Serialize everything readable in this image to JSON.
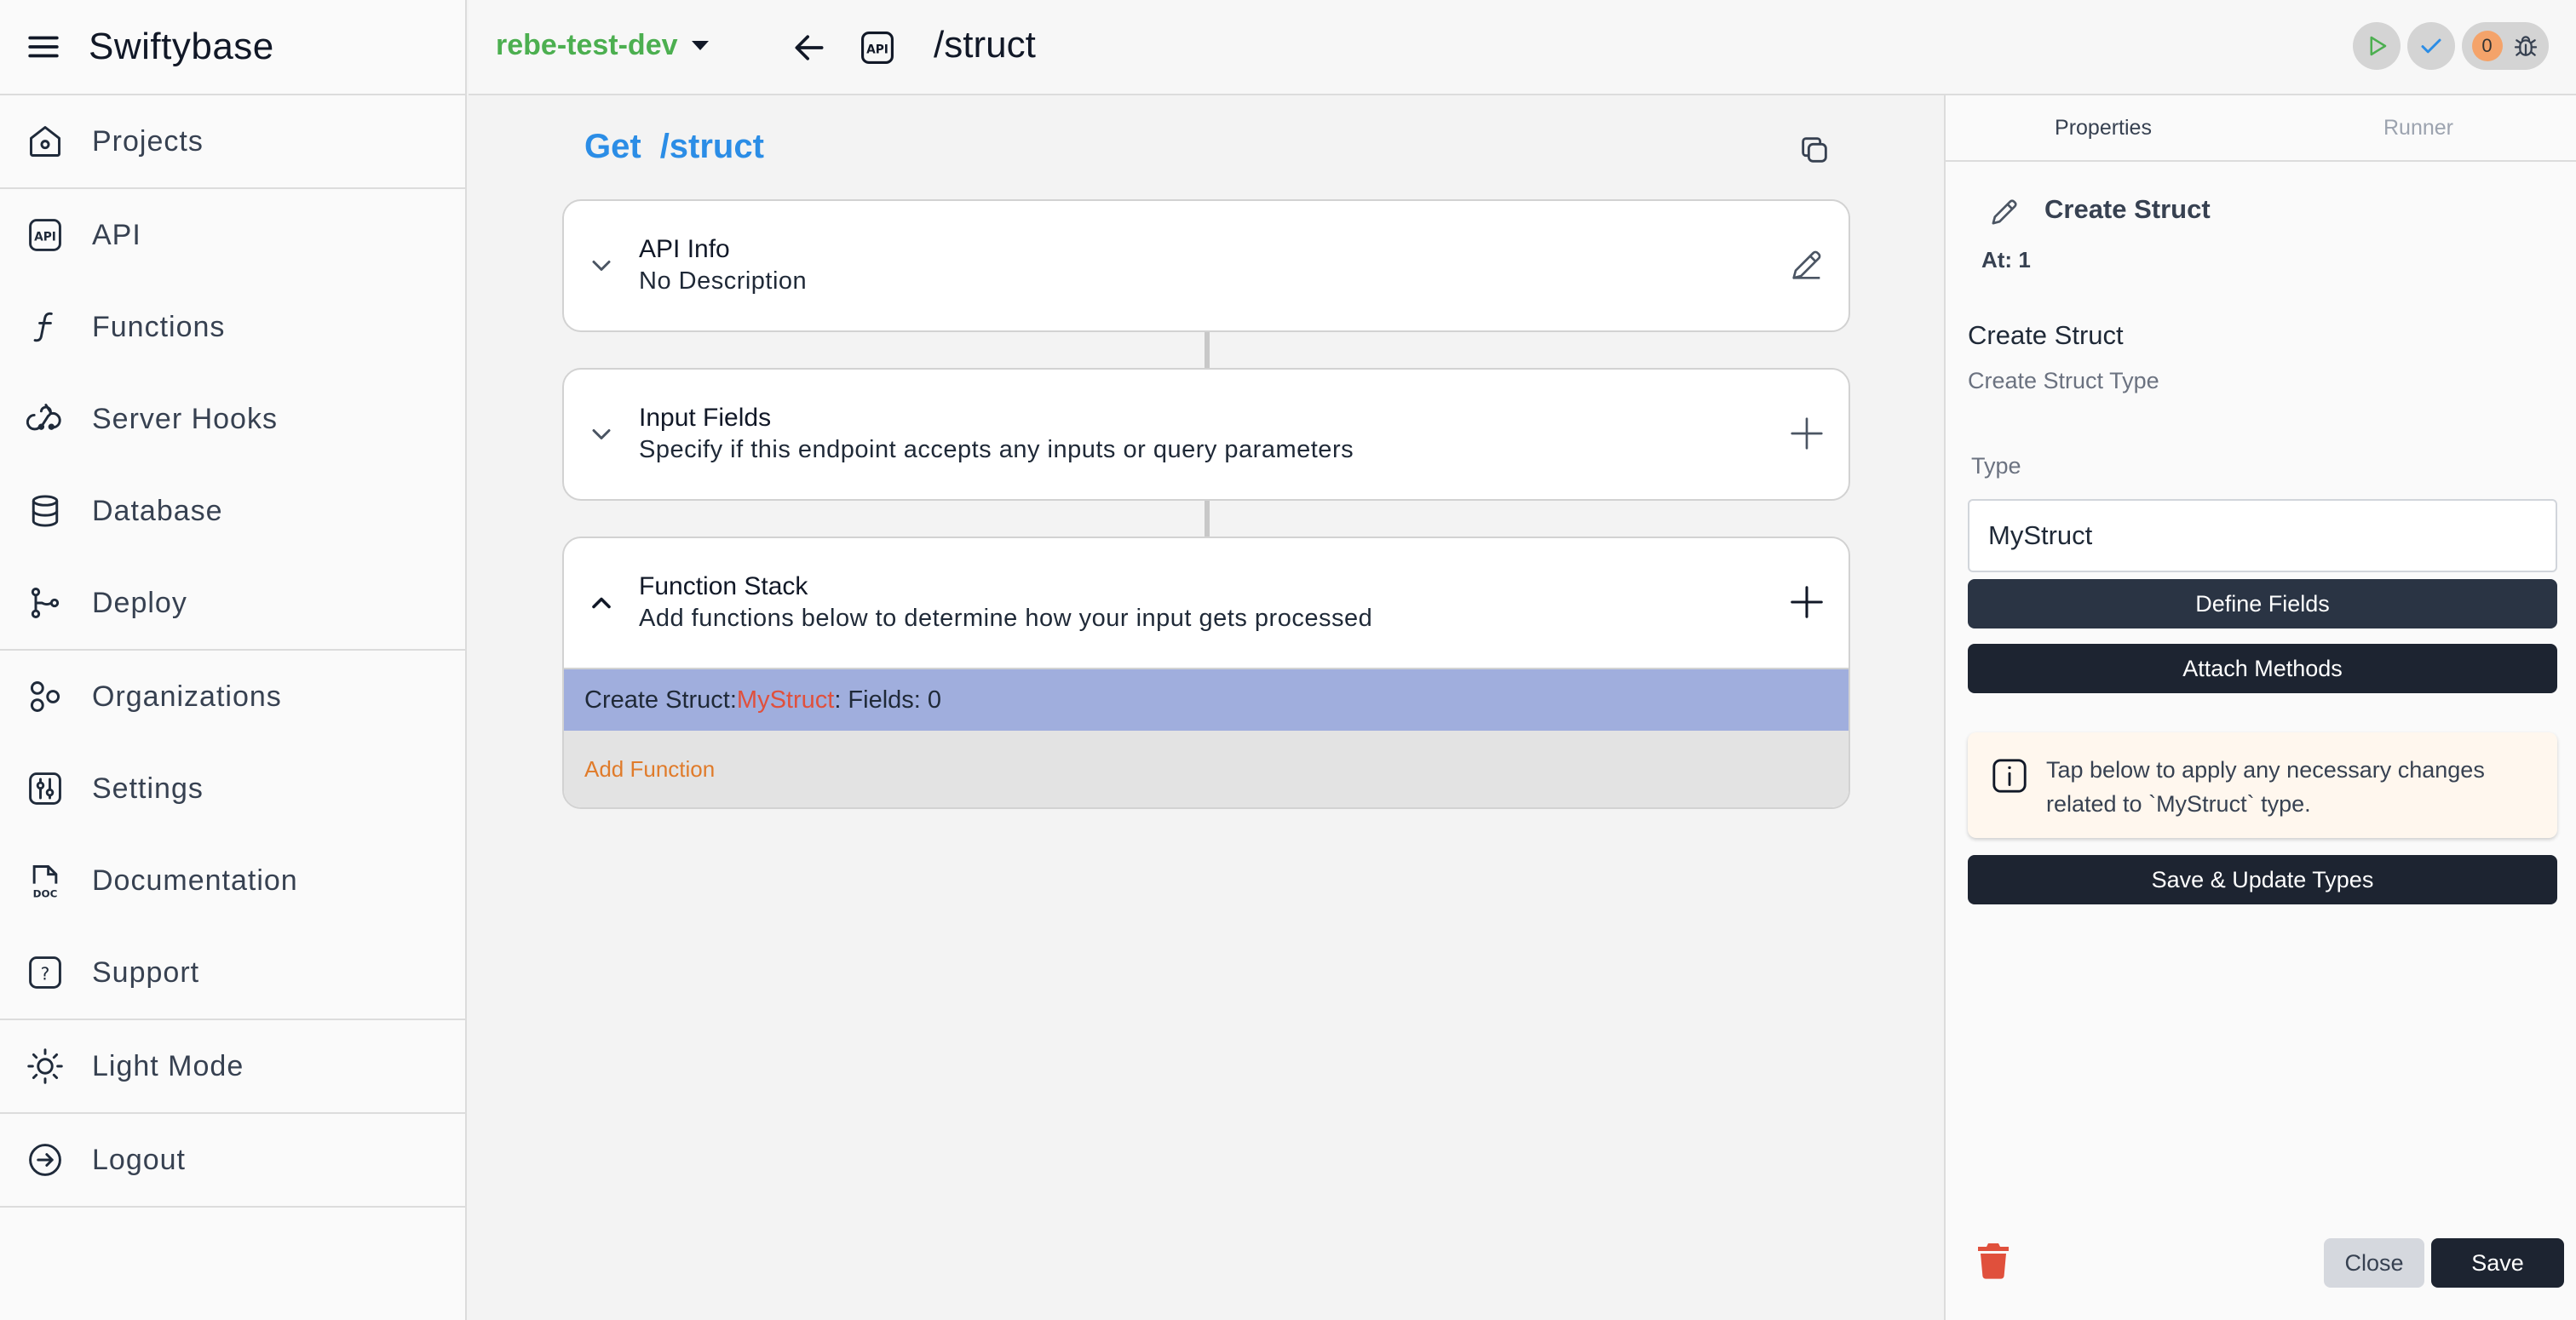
{
  "sidebar": {
    "brand": "Swiftybase",
    "groups": [
      [
        {
          "label": "Projects",
          "icon": "house-icon"
        }
      ],
      [
        {
          "label": "API",
          "icon": "api-icon"
        },
        {
          "label": "Functions",
          "icon": "function-icon"
        },
        {
          "label": "Server Hooks",
          "icon": "webhook-icon"
        },
        {
          "label": "Database",
          "icon": "database-icon"
        },
        {
          "label": "Deploy",
          "icon": "git-branch-icon"
        }
      ],
      [
        {
          "label": "Organizations",
          "icon": "organizations-icon"
        },
        {
          "label": "Settings",
          "icon": "settings-icon"
        },
        {
          "label": "Documentation",
          "icon": "doc-icon"
        },
        {
          "label": "Support",
          "icon": "help-icon"
        }
      ],
      [
        {
          "label": "Light Mode",
          "icon": "sun-icon"
        }
      ],
      [
        {
          "label": "Logout",
          "icon": "logout-icon"
        }
      ]
    ]
  },
  "topbar": {
    "project": "rebe-test-dev",
    "path": "/struct",
    "api_badge": "API",
    "error_count": "0"
  },
  "endpoint": {
    "method": "Get",
    "path": "/struct"
  },
  "cards": {
    "api_info": {
      "title": "API Info",
      "desc": "No Description"
    },
    "input_fields": {
      "title": "Input Fields",
      "desc": "Specify if this endpoint accepts any inputs or query parameters"
    },
    "function_stack": {
      "title": "Function Stack",
      "desc": "Add functions below to determine how your input gets processed"
    }
  },
  "function_row": {
    "prefix": "Create Struct: ",
    "type": "MyStruct",
    "suffix": ": Fields: 0"
  },
  "add_function": "Add Function",
  "panel": {
    "tabs": [
      "Properties",
      "Runner"
    ],
    "title": "Create Struct",
    "at": "At: 1",
    "section_title": "Create Struct",
    "section_desc": "Create Struct Type",
    "type_label": "Type",
    "type_value": "MyStruct",
    "define_fields": "Define Fields",
    "attach_methods": "Attach Methods",
    "note": "Tap below to apply any necessary changes related to `MyStruct` type.",
    "save_update": "Save & Update Types",
    "close": "Close",
    "save": "Save"
  },
  "colors": {
    "project": "#4caf50",
    "endpoint": "#2b8de6",
    "function_row_bg": "#a0aedd",
    "type_highlight": "#e0503c",
    "add_function": "#e07b2a",
    "button_dark": "#1d2431",
    "delete": "#e0503c"
  }
}
